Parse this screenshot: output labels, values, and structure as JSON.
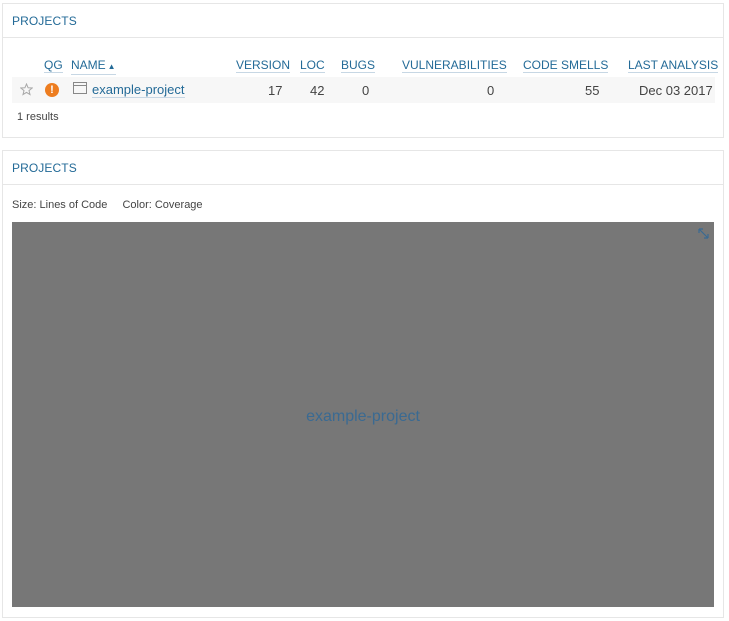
{
  "projects_list": {
    "title": "PROJECTS",
    "columns": {
      "qg": "QG",
      "name": "NAME",
      "version": "VERSION",
      "loc": "LOC",
      "bugs": "BUGS",
      "vulnerabilities": "VULNERABILITIES",
      "code_smells": "CODE SMELLS",
      "last_analysis": "LAST ANALYSIS"
    },
    "sort_indicator": "▲",
    "rows": [
      {
        "qg_symbol": "!",
        "qg_color": "#ed7d20",
        "name": "example-project",
        "version": "17",
        "loc": "42",
        "bugs": "0",
        "vulnerabilities": "0",
        "code_smells": "55",
        "last_analysis": "Dec 03 2017"
      }
    ],
    "results_text": "1 results"
  },
  "projects_treemap": {
    "title": "PROJECTS",
    "size_label": "Size: Lines of Code",
    "color_label": "Color: Coverage",
    "cell_label": "example-project",
    "cell_color": "#777777"
  },
  "colors": {
    "link": "#236a97",
    "border": "#e6e6e6",
    "row_bg": "#f7f7f7"
  }
}
